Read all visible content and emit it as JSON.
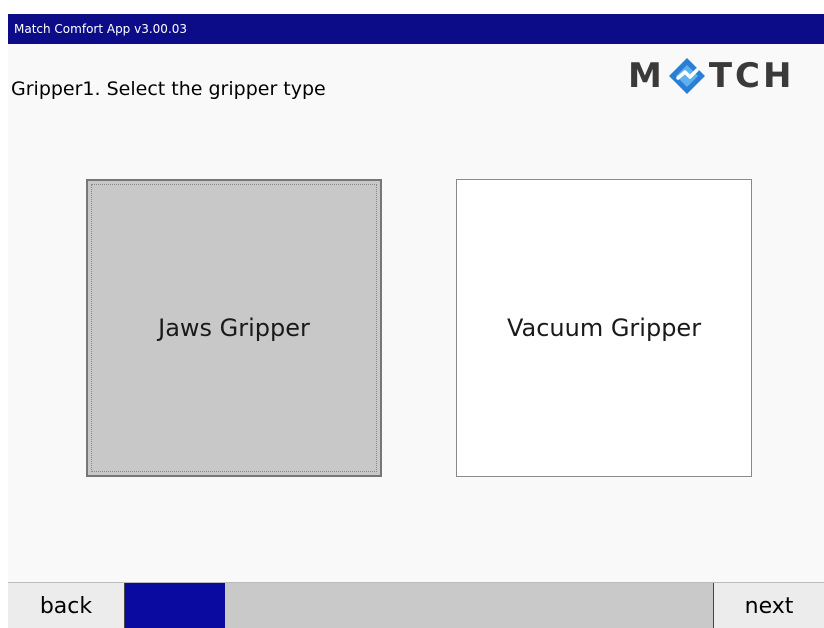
{
  "app": {
    "title": "Match Comfort App v3.00.03"
  },
  "header": {
    "instruction": "Gripper1. Select the gripper type",
    "logo_text_left": "M",
    "logo_text_right": "TCH",
    "logo_icon": "match-diamond-icon",
    "logo_colors": {
      "text": "#3a3a3a",
      "icon": "#2a7fd4"
    }
  },
  "options": [
    {
      "label": "Jaws Gripper",
      "selected": true
    },
    {
      "label": "Vacuum Gripper",
      "selected": false
    }
  ],
  "footer": {
    "back_label": "back",
    "next_label": "next",
    "progress": 0.17
  },
  "colors": {
    "titlebar": "#0c0c88",
    "progress_fill": "#0a0aa0",
    "selected_option": "#c8c8c8"
  }
}
